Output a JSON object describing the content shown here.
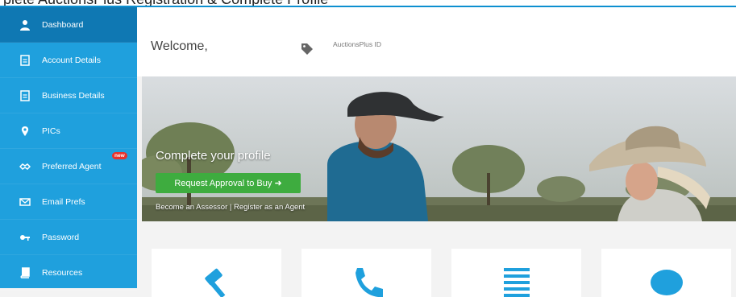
{
  "topbar": {
    "text": "plete AuctionsPlus Registration & Complete Profile"
  },
  "sidebar": {
    "items": [
      {
        "label": "Dashboard",
        "icon": "user-icon"
      },
      {
        "label": "Account Details",
        "icon": "document-icon"
      },
      {
        "label": "Business Details",
        "icon": "document-icon"
      },
      {
        "label": "PICs",
        "icon": "map-pin-icon"
      },
      {
        "label": "Preferred Agent",
        "icon": "handshake-icon",
        "badge": "new"
      },
      {
        "label": "Email Prefs",
        "icon": "envelope-icon"
      },
      {
        "label": "Password",
        "icon": "key-icon"
      },
      {
        "label": "Resources",
        "icon": "book-icon"
      }
    ]
  },
  "header": {
    "welcome": "Welcome,",
    "id_label": "AuctionsPlus ID"
  },
  "hero": {
    "title": "Complete your profile",
    "button_label": "Request Approval to Buy ➜",
    "link_assessor": "Become an Assessor",
    "separator": "|",
    "link_agent": "Register as an Agent"
  },
  "cards": [
    {
      "icon": "gavel-icon"
    },
    {
      "icon": "phone-icon"
    },
    {
      "icon": "list-icon"
    },
    {
      "icon": "chat-bubble-icon"
    }
  ],
  "colors": {
    "sidebar": "#1fa0dd",
    "sidebar_active": "#0f78b3",
    "button_green": "#3eac3f",
    "badge_red": "#e8322b",
    "icon_blue": "#1fa0dd"
  }
}
